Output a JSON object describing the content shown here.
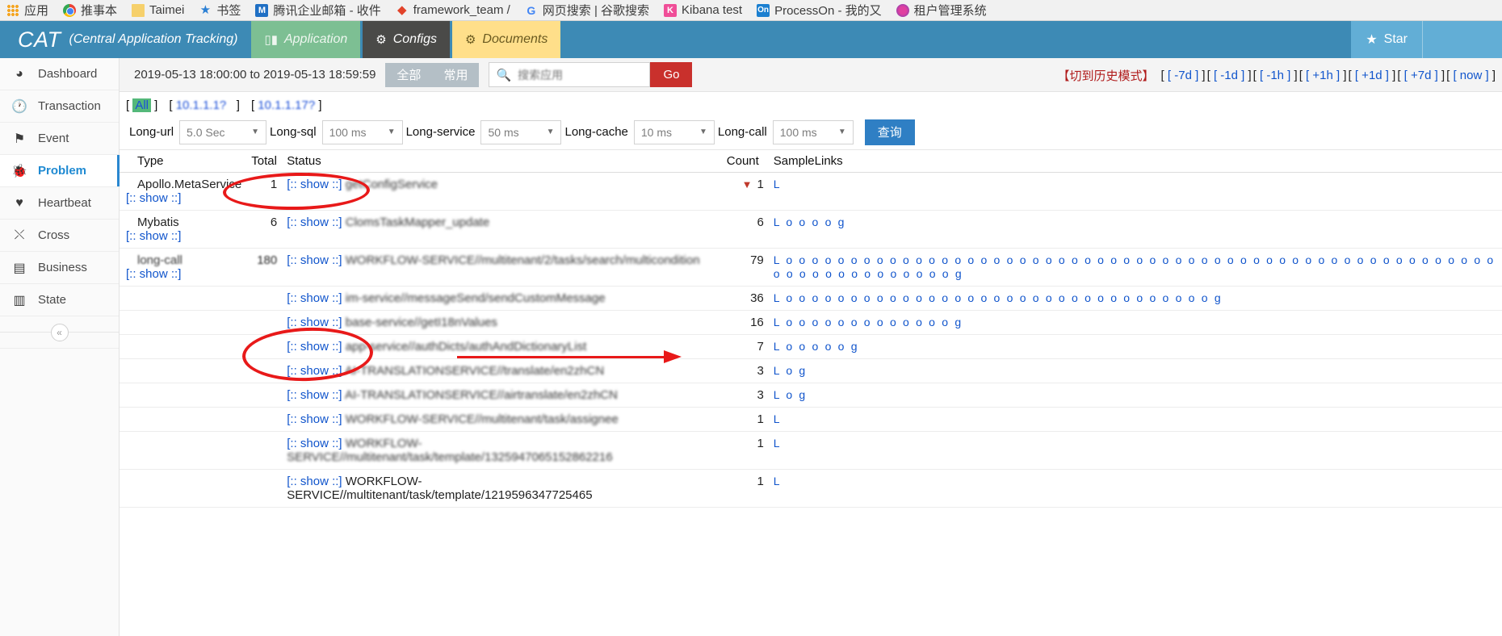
{
  "browser": {
    "bookmarks": [
      {
        "label": "应用",
        "icon": "apps-grid-icon"
      },
      {
        "label": "推事本",
        "icon": "chrome-icon"
      },
      {
        "label": "Taimei",
        "icon": "folder-icon"
      },
      {
        "label": "书签",
        "icon": "star-icon"
      },
      {
        "label": "腾讯企业邮箱 - 收件",
        "icon": "tencent-mail-icon"
      },
      {
        "label": "framework_team /",
        "icon": "gitlab-icon"
      },
      {
        "label": "网页搜索 | 谷歌搜索",
        "icon": "google-icon"
      },
      {
        "label": "Kibana test",
        "icon": "kibana-icon"
      },
      {
        "label": "ProcessOn - 我的又",
        "icon": "processon-icon"
      },
      {
        "label": "租户管理系统",
        "icon": "tenant-system-icon"
      }
    ]
  },
  "header": {
    "brand": "CAT",
    "brand_subtitle": "(Central Application Tracking)",
    "tabs": [
      {
        "label": "Application",
        "icon": "bar-chart-icon",
        "state": "inactive"
      },
      {
        "label": "Configs",
        "icon": "gears-icon",
        "state": "active"
      },
      {
        "label": "Documents",
        "icon": "gears-icon",
        "state": "inactive"
      }
    ],
    "star_label": "Star",
    "star_icon": "star-icon",
    "colors": {
      "header_bg": "#3d8ab5",
      "tab_application_bg": "#7dbf93",
      "tab_configs_bg": "#4a4a48",
      "tab_documents_bg": "#ffdf8a",
      "star_bg": "#62aed6"
    }
  },
  "sidebar": {
    "items": [
      {
        "label": "Dashboard",
        "icon": "dashboard-icon",
        "active": false
      },
      {
        "label": "Transaction",
        "icon": "clock-icon",
        "active": false
      },
      {
        "label": "Event",
        "icon": "flag-icon",
        "active": false
      },
      {
        "label": "Problem",
        "icon": "bug-icon",
        "active": true
      },
      {
        "label": "Heartbeat",
        "icon": "heart-icon",
        "active": false
      },
      {
        "label": "Cross",
        "icon": "shuffle-icon",
        "active": false
      },
      {
        "label": "Business",
        "icon": "list-icon",
        "active": false
      },
      {
        "label": "State",
        "icon": "bar-chart-icon",
        "active": false
      }
    ],
    "collapse_icon": "chevron-double-left-icon"
  },
  "toolbar": {
    "date_range": "2019-05-13 18:00:00 to 2019-05-13 18:59:59",
    "segment_all": "全部",
    "segment_common": "常用",
    "search_icon": "search-icon",
    "search_value": "",
    "search_placeholder": "搜索应用",
    "go_label": "Go",
    "history_mode": "【切到历史模式】",
    "time_shortcuts": [
      "[ -7d ]",
      "[ -1d ]",
      "[ -1h ]",
      "[ +1h ]",
      "[ +1d ]",
      "[ +7d ]",
      "[ now ]"
    ]
  },
  "ip_filter": {
    "items": [
      {
        "label": "All",
        "selected": true
      },
      {
        "label": "10.1.1.1?",
        "selected": false
      },
      {
        "label": "10.1.1.17?",
        "selected": false
      }
    ]
  },
  "filters": [
    {
      "label": "Long-url",
      "value": "5.0 Sec"
    },
    {
      "label": "Long-sql",
      "value": "100 ms"
    },
    {
      "label": "Long-service",
      "value": "50 ms"
    },
    {
      "label": "Long-cache",
      "value": "10 ms"
    },
    {
      "label": "Long-call",
      "value": "100 ms"
    }
  ],
  "query_button_label": "查询",
  "table": {
    "headers": [
      "Type",
      "Total",
      "Status",
      "Count",
      "SampleLinks"
    ],
    "show_label": "[:: show ::]",
    "rows": [
      {
        "type": "Apollo.MetaService",
        "type_show": "[:: show ::]",
        "total": "1",
        "status": "getConfigService",
        "status_blurred": true,
        "has_down_triangle": true,
        "count": "1",
        "links": "L"
      },
      {
        "type": "Mybatis",
        "type_show": "[:: show ::]",
        "total": "6",
        "status": "ClomsTaskMapper_update",
        "status_blurred": true,
        "has_down_triangle": false,
        "count": "6",
        "links": "L o o o o g"
      },
      {
        "type": "long-call",
        "type_show": "[:: show ::]",
        "total": "180",
        "status": "WORKFLOW-SERVICE//multitenant/2/tasks/search/multicondition",
        "status_blurred": true,
        "has_down_triangle": false,
        "count": "79",
        "links": "L o o o o o o o o o o o o o o o o o o o o o o o o o o o o o o o o o o o o o o o o o o o o o o o o o o o o o o o o o o o o o o o o o o o o o g"
      },
      {
        "type": "",
        "type_show": "",
        "total": "",
        "status": "im-service//messageSend/sendCustomMessage",
        "status_blurred": true,
        "has_down_triangle": false,
        "count": "36",
        "links": "L o o o o o o o o o o o o o o o o o o o o o o o o o o o o o o o o o g"
      },
      {
        "type": "",
        "type_show": "",
        "total": "",
        "status": "base-service//getI18nValues",
        "status_blurred": true,
        "has_down_triangle": false,
        "count": "16",
        "links": "L o o o o o o o o o o o o o g"
      },
      {
        "type": "",
        "type_show": "",
        "total": "",
        "status": "app-service//authDicts/authAndDictionaryList",
        "status_blurred": true,
        "has_down_triangle": false,
        "count": "7",
        "links": "L o o o o o g"
      },
      {
        "type": "",
        "type_show": "",
        "total": "",
        "status": "AI-TRANSLATIONSERVICE//translate/en2zhCN",
        "status_blurred": true,
        "has_down_triangle": false,
        "count": "3",
        "links": "L o g"
      },
      {
        "type": "",
        "type_show": "",
        "total": "",
        "status": "AI-TRANSLATIONSERVICE//airtranslate/en2zhCN",
        "status_blurred": true,
        "has_down_triangle": false,
        "count": "3",
        "links": "L o g"
      },
      {
        "type": "",
        "type_show": "",
        "total": "",
        "status": "WORKFLOW-SERVICE//multitenant/task/assignee",
        "status_blurred": true,
        "has_down_triangle": false,
        "count": "1",
        "links": "L"
      },
      {
        "type": "",
        "type_show": "",
        "total": "",
        "status": "WORKFLOW-SERVICE//multitenant/task/template/1325947065152862216",
        "status_blurred": true,
        "has_down_triangle": false,
        "count": "1",
        "links": "L"
      },
      {
        "type": "",
        "type_show": "",
        "total": "",
        "status": "WORKFLOW-SERVICE//multitenant/task/template/1219596347725465",
        "status_blurred": false,
        "has_down_triangle": false,
        "count": "1",
        "links": "L"
      }
    ]
  },
  "annotations": {
    "oval_long_url": "highlight-long-url-filter",
    "oval_long_call": "highlight-long-call-row",
    "arrow": "arrow-pointing-right"
  }
}
